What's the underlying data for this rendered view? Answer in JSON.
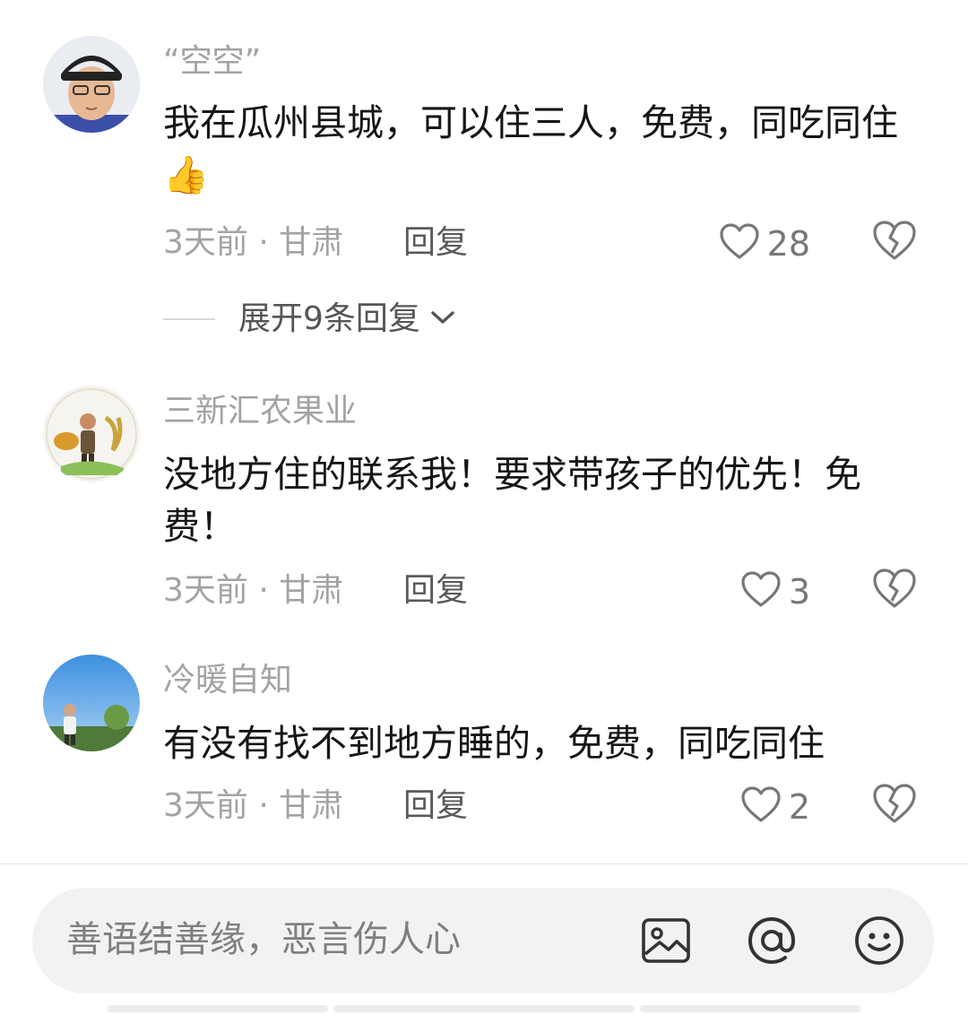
{
  "comments": [
    {
      "username": "“空空”",
      "text": "我在瓜州县城，可以住三人，免费，同吃同住👍",
      "meta": "3天前 · 甘肃",
      "reply_label": "回复",
      "likes": "28",
      "expand_label": "展开9条回复"
    },
    {
      "username": "三新汇农果业",
      "text": "没地方住的联系我！要求带孩子的优先！免费！",
      "meta": "3天前 · 甘肃",
      "reply_label": "回复",
      "likes": "3"
    },
    {
      "username": "冷暖自知",
      "text": "有没有找不到地方睡的，免费，同吃同住",
      "meta": "3天前 · 甘肃",
      "reply_label": "回复",
      "likes": "2"
    }
  ],
  "input_bar": {
    "placeholder": "善语结善缘，恶言伤人心",
    "icons": [
      "image-icon",
      "at-icon",
      "emoji-icon"
    ]
  },
  "icons": {
    "like": "heart-outline-icon",
    "dislike": "broken-heart-icon",
    "expand": "chevron-down-icon"
  }
}
